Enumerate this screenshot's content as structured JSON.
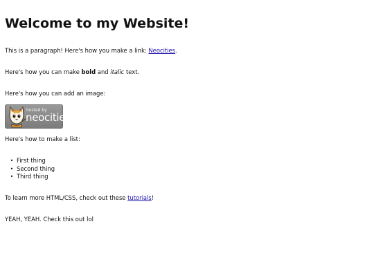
{
  "heading": "Welcome to my Website!",
  "paragraph_link": {
    "text_before": "This is a paragraph! Here's how you make a link: ",
    "link_label": "Neocities",
    "text_after": "."
  },
  "paragraph_format": {
    "text_before": "Here's how you can make ",
    "bold_text": "bold",
    "text_middle": " and ",
    "italic_text": "italic",
    "text_after": " text."
  },
  "paragraph_image": "Here's how you can add an image:",
  "badge_image": {
    "small_text": "hosted by",
    "brand_text": "neocities",
    "icon": "neocities-cat-icon"
  },
  "paragraph_list": "Here's how to make a list:",
  "list_items": [
    {
      "label": "First thing"
    },
    {
      "label": "Second thing"
    },
    {
      "label": "Third thing"
    }
  ],
  "bullet_glyph": "•",
  "paragraph_tutorials": {
    "text_before": "To learn more HTML/CSS, check out these ",
    "link_label": "tutorials",
    "text_after": "!"
  },
  "paragraph_last": "YEAH, YEAH. Check this out lol",
  "colors": {
    "link": "#1a0dab",
    "text": "#111111",
    "badge_background": "#8a8a8a"
  }
}
